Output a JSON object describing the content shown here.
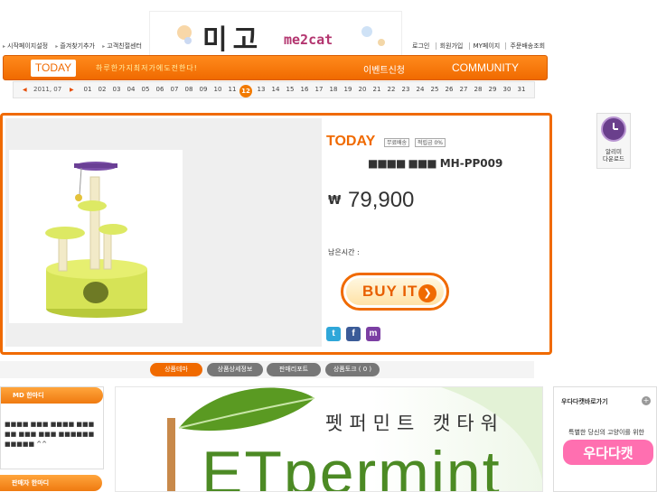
{
  "logo": {
    "korean": "미고",
    "brand": "me2cat"
  },
  "top_links_left": [
    "시작페이지설정",
    "즐겨찾기추가",
    "고객친절센터"
  ],
  "top_links_right": [
    "로그인",
    "회원가입",
    "MY페이지",
    "주문배송조회"
  ],
  "nav": {
    "today": "TODAY",
    "marquee": "하루한가지최저가에도전한다!",
    "event": "이벤트신청",
    "community": "COMMUNITY"
  },
  "date_bar": {
    "prev": "◀",
    "month": "2011, 07",
    "next": "▶",
    "days": [
      "01",
      "02",
      "03",
      "04",
      "05",
      "06",
      "07",
      "08",
      "09",
      "10",
      "11",
      "12",
      "13",
      "14",
      "15",
      "16",
      "17",
      "18",
      "19",
      "20",
      "21",
      "22",
      "23",
      "24",
      "25",
      "26",
      "27",
      "28",
      "29",
      "30",
      "31"
    ],
    "active_day": "12"
  },
  "product": {
    "today": "TODAY",
    "badge_shipping": "무료배송",
    "badge_points": "적립금 0%",
    "name_masked": "■■■■ ■■■",
    "model": "MH-PP009",
    "currency": "₩",
    "price": "79,900",
    "remaining_label": "남은시간 :",
    "buy_label": "BUY IT",
    "buy_arrow": "❯"
  },
  "social": [
    {
      "name": "twitter",
      "glyph": "t",
      "color": "#2fa7d9"
    },
    {
      "name": "facebook",
      "glyph": "f",
      "color": "#3b5b98"
    },
    {
      "name": "me2day",
      "glyph": "m",
      "color": "#7b3fa3"
    }
  ],
  "alarm": {
    "label_line1": "알리미",
    "label_line2": "다운로드"
  },
  "tabs": [
    {
      "label": "상품테마",
      "color": "#f06a00"
    },
    {
      "label": "상품상세정보",
      "color": "#777777"
    },
    {
      "label": "판매리포트",
      "color": "#777777"
    },
    {
      "label": "상품토크 ( 0 )",
      "color": "#777777"
    }
  ],
  "md_box": {
    "title": "MD 한마디",
    "text": "■■■■ ■■■ ■■■■ ■■■ ■■ ■■■ ■■■ ■■■■■■ ■■■■■ ^^"
  },
  "seller_box": {
    "title": "판매자 한마디"
  },
  "banner": {
    "korean": "펫퍼민트 캣타워",
    "english": "ETpermint"
  },
  "promo": {
    "title": "우다다캣바로가기",
    "plus": "+",
    "desc": "특별한 당신의 고양이를 위한",
    "logo_text": "우다다캣"
  },
  "colors": {
    "accent": "#f06a00",
    "price": "#333333",
    "banner_green": "#4c8a24"
  }
}
